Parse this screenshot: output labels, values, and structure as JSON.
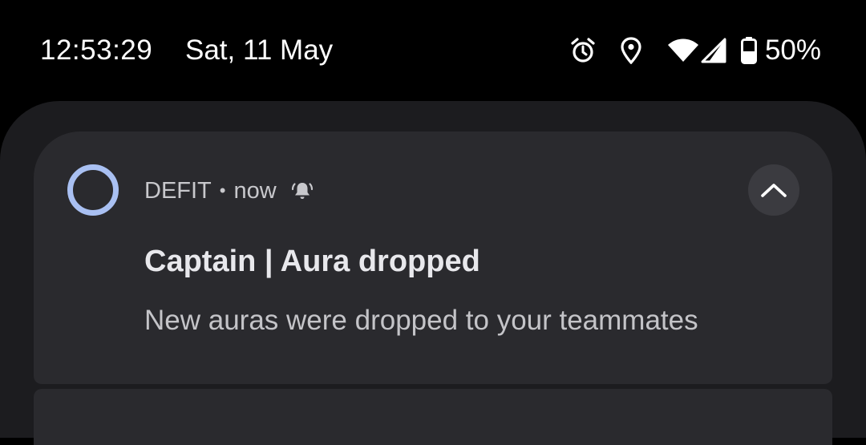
{
  "status_bar": {
    "time": "12:53:29",
    "date": "Sat, 11 May",
    "battery_percent": "50%",
    "icons": [
      "alarm-icon",
      "location-icon",
      "wifi-icon",
      "cellular-signal-icon",
      "battery-icon"
    ]
  },
  "notification": {
    "app_name": "DEFIT",
    "separator": "•",
    "time": "now",
    "title": "Captain | Aura dropped",
    "body": "New auras were dropped to your teammates",
    "alert_icon": "bell-alert-icon",
    "expand_icon": "chevron-up-icon"
  },
  "colors": {
    "background": "#000000",
    "shade": "#1c1c1f",
    "card": "#2a2a2e",
    "app_icon_ring": "#a9c0f2",
    "expand_button": "#3b3b40"
  }
}
